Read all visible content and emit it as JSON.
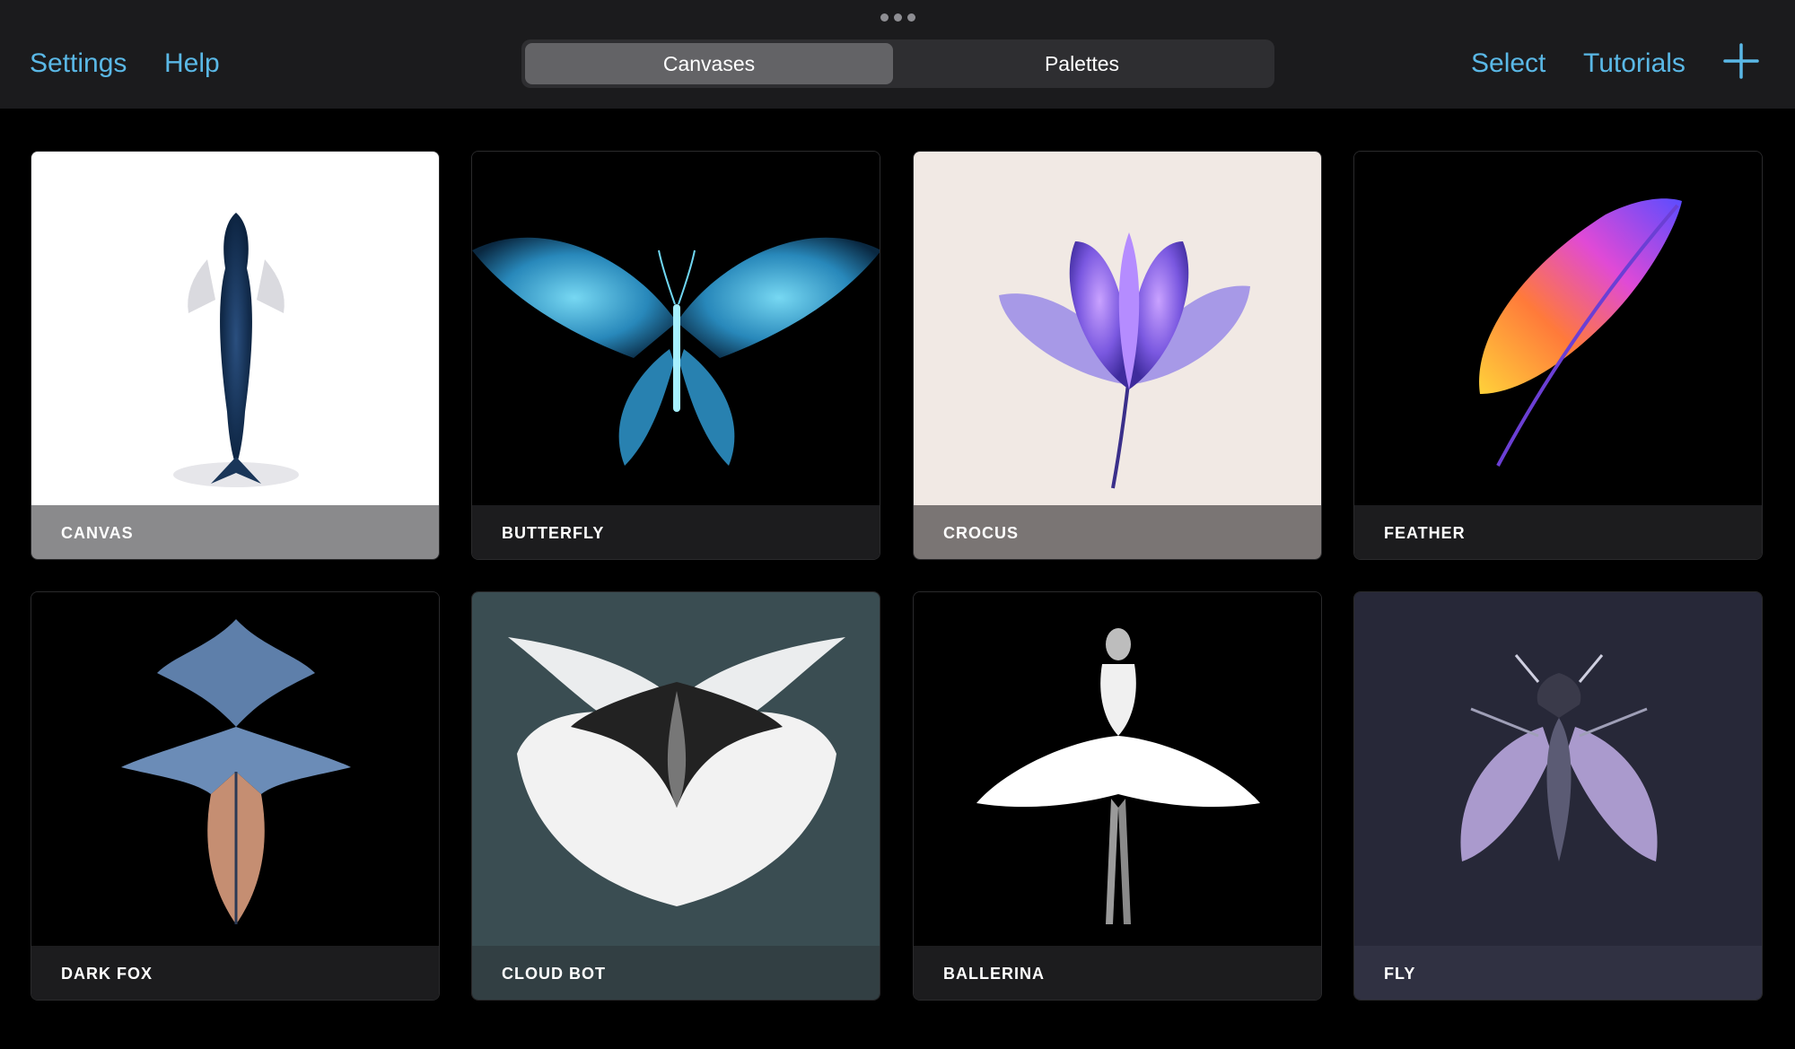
{
  "topbar": {
    "left_links": [
      "Settings",
      "Help"
    ],
    "tabs": [
      {
        "label": "Canvases",
        "active": true
      },
      {
        "label": "Palettes",
        "active": false
      }
    ],
    "right_links": [
      "Select",
      "Tutorials"
    ],
    "add_icon": "plus-icon"
  },
  "colors": {
    "accent": "#5ab8e6",
    "background": "#000000",
    "bar": "#1b1b1d"
  },
  "gallery": {
    "cards": [
      {
        "title": "CANVAS",
        "art": "whale-silhouette"
      },
      {
        "title": "BUTTERFLY",
        "art": "blue-butterfly"
      },
      {
        "title": "CROCUS",
        "art": "purple-crocus-flower"
      },
      {
        "title": "FEATHER",
        "art": "rainbow-feather"
      },
      {
        "title": "DARK FOX",
        "art": "symmetrical-fox-figure"
      },
      {
        "title": "CLOUD BOT",
        "art": "symmetrical-cloud-bot"
      },
      {
        "title": "BALLERINA",
        "art": "white-ballerina"
      },
      {
        "title": "FLY",
        "art": "purple-fly"
      }
    ]
  }
}
